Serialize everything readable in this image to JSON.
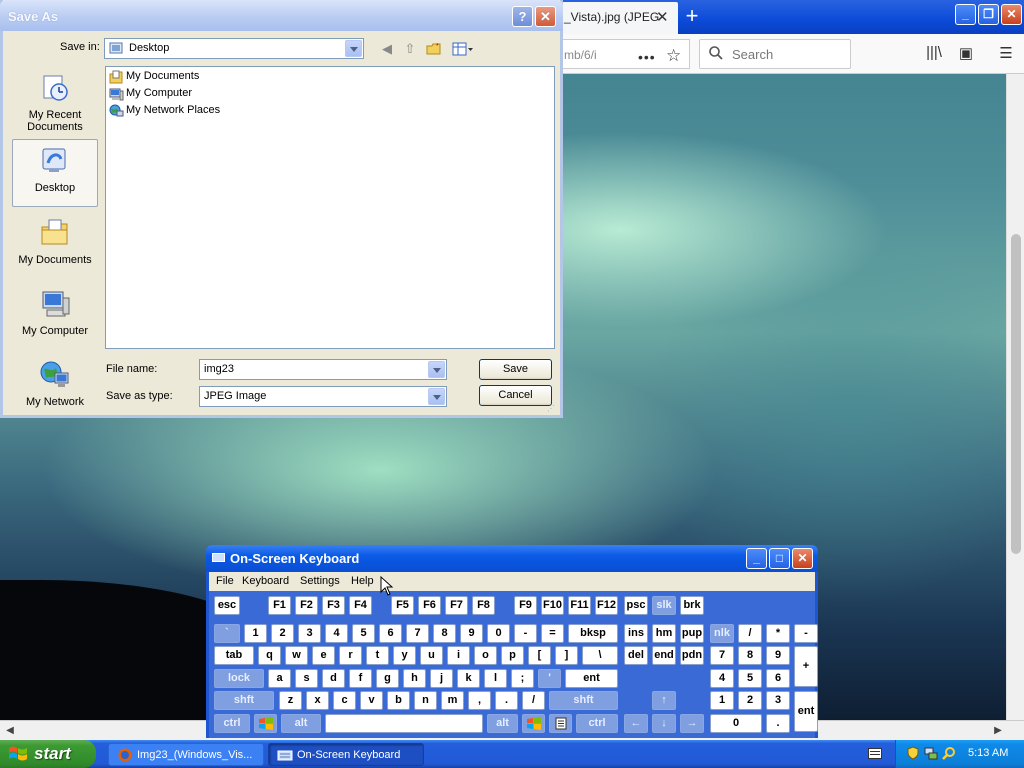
{
  "browser": {
    "tab_title": "_Vista).jpg (JPEG",
    "url_text": "mb/6/i",
    "search_placeholder": "Search"
  },
  "save_dialog": {
    "title": "Save As",
    "save_in_label": "Save in:",
    "save_in_value": "Desktop",
    "places": [
      {
        "label": "My Recent Documents",
        "icon": "recent-documents-icon"
      },
      {
        "label": "Desktop",
        "icon": "desktop-icon"
      },
      {
        "label": "My Documents",
        "icon": "my-documents-icon"
      },
      {
        "label": "My Computer",
        "icon": "my-computer-icon"
      },
      {
        "label": "My Network",
        "icon": "my-network-icon"
      }
    ],
    "files": [
      {
        "label": "My Documents",
        "icon": "folder-icon"
      },
      {
        "label": "My Computer",
        "icon": "computer-icon"
      },
      {
        "label": "My Network Places",
        "icon": "network-icon"
      }
    ],
    "file_name_label": "File name:",
    "file_name_value": "img23",
    "save_as_type_label": "Save as type:",
    "save_as_type_value": "JPEG Image",
    "save_button": "Save",
    "cancel_button": "Cancel"
  },
  "osk": {
    "title": "On-Screen Keyboard",
    "menu": [
      "File",
      "Keyboard",
      "Settings",
      "Help"
    ],
    "keys": {
      "esc": "esc",
      "f1": "F1",
      "f2": "F2",
      "f3": "F3",
      "f4": "F4",
      "f5": "F5",
      "f6": "F6",
      "f7": "F7",
      "f8": "F8",
      "f9": "F9",
      "f10": "F10",
      "f11": "F11",
      "f12": "F12",
      "psc": "psc",
      "slk": "slk",
      "brk": "brk",
      "backtick": "`",
      "n1": "1",
      "n2": "2",
      "n3": "3",
      "n4": "4",
      "n5": "5",
      "n6": "6",
      "n7": "7",
      "n8": "8",
      "n9": "9",
      "n0": "0",
      "minus": "-",
      "equals": "=",
      "bksp": "bksp",
      "ins": "ins",
      "hm": "hm",
      "pup": "pup",
      "nlk": "nlk",
      "np_div": "/",
      "np_mul": "*",
      "np_sub": "-",
      "tab": "tab",
      "q": "q",
      "w": "w",
      "e": "e",
      "r": "r",
      "t": "t",
      "y": "y",
      "u": "u",
      "i": "i",
      "o": "o",
      "p": "p",
      "lbracket": "[",
      "rbracket": "]",
      "backslash": "\\",
      "del": "del",
      "end": "end",
      "pdn": "pdn",
      "np7": "7",
      "np8": "8",
      "np9": "9",
      "np_add": "+",
      "lock": "lock",
      "a": "a",
      "s": "s",
      "d": "d",
      "f": "f",
      "g": "g",
      "h": "h",
      "j": "j",
      "k": "k",
      "l": "l",
      "semicolon": ";",
      "quote": "'",
      "ent": "ent",
      "np4": "4",
      "np5": "5",
      "np6": "6",
      "shft": "shft",
      "z": "z",
      "x": "x",
      "c": "c",
      "v": "v",
      "b": "b",
      "n": "n",
      "m": "m",
      "comma": ",",
      "period": ".",
      "slash": "/",
      "up": "↑",
      "np1": "1",
      "np2": "2",
      "np3": "3",
      "np_ent": "ent",
      "ctrl": "ctrl",
      "alt": "alt",
      "left": "←",
      "down": "↓",
      "right": "→",
      "np0": "0",
      "np_dot": "."
    }
  },
  "taskbar": {
    "start_label": "start",
    "tasks": [
      "Img23_(Windows_Vis...",
      "On-Screen Keyboard"
    ],
    "clock": "5:13 AM"
  }
}
